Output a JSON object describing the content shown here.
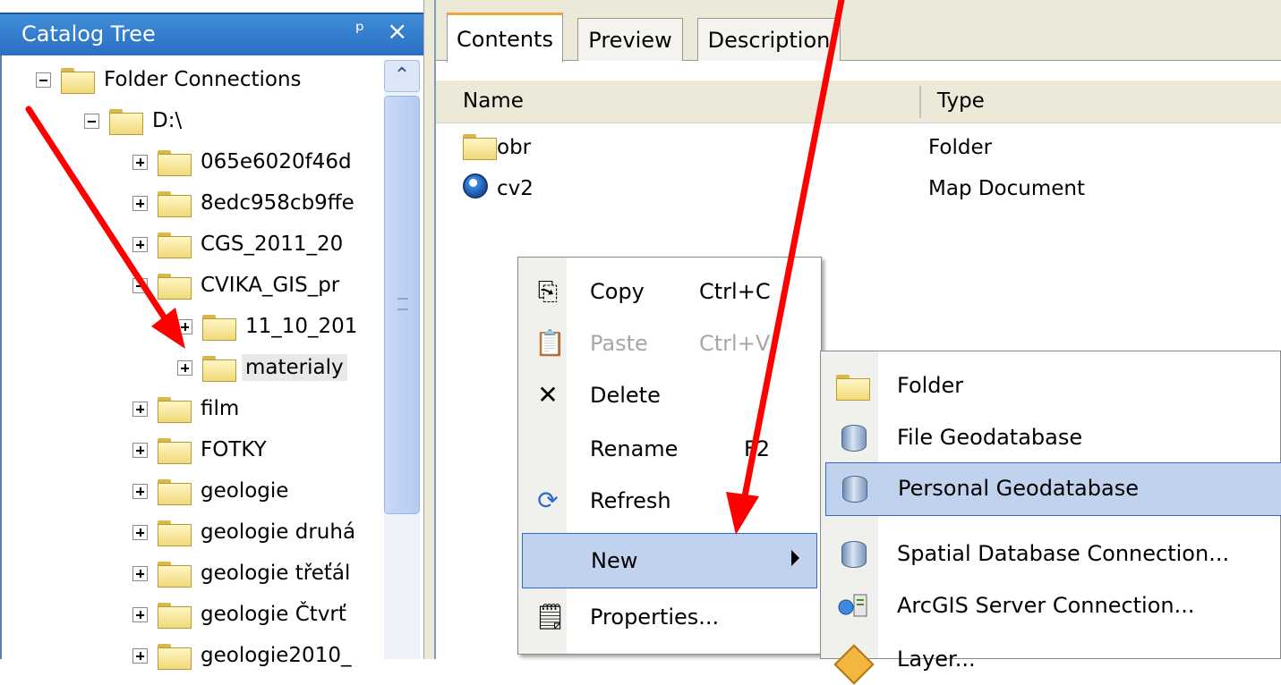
{
  "catalog_tree": {
    "title": "Catalog Tree",
    "pin_glyph": "ᵖ",
    "close_glyph": "×",
    "items": [
      {
        "label": "Folder Connections",
        "expander": "minus"
      },
      {
        "label": "D:\\",
        "expander": "minus"
      },
      {
        "label": "065e6020f46d",
        "expander": "plus"
      },
      {
        "label": "8edc958cb9ffe",
        "expander": "plus"
      },
      {
        "label": "CGS_2011_20",
        "expander": "plus"
      },
      {
        "label": "CVIKA_GIS_pr",
        "expander": "minus"
      },
      {
        "label": "11_10_201",
        "expander": "plus"
      },
      {
        "label": "materialy",
        "expander": "plus",
        "selected": true
      },
      {
        "label": "film",
        "expander": "plus"
      },
      {
        "label": "FOTKY",
        "expander": "plus"
      },
      {
        "label": "geologie",
        "expander": "plus"
      },
      {
        "label": "geologie druhá",
        "expander": "plus"
      },
      {
        "label": "geologie třeťál",
        "expander": "plus"
      },
      {
        "label": "geologie Čtvrť",
        "expander": "plus"
      },
      {
        "label": "geologie2010_",
        "expander": "plus"
      }
    ]
  },
  "tabs": [
    {
      "label": "Contents",
      "active": true
    },
    {
      "label": "Preview"
    },
    {
      "label": "Description"
    }
  ],
  "list": {
    "columns": {
      "name": "Name",
      "type": "Type"
    },
    "rows": [
      {
        "name": "obr",
        "type": "Folder",
        "icon": "folder-icon"
      },
      {
        "name": "cv2",
        "type": "Map Document",
        "icon": "map-document-icon"
      }
    ]
  },
  "context_menu": {
    "items": [
      {
        "label": "Copy",
        "shortcut": "Ctrl+C",
        "icon": "copy-icon"
      },
      {
        "label": "Paste",
        "shortcut": "Ctrl+V",
        "icon": "paste-icon",
        "disabled": true
      },
      {
        "label": "Delete",
        "shortcut": "",
        "icon": "delete-icon"
      },
      {
        "label": "Rename",
        "shortcut": "F2",
        "icon": ""
      },
      {
        "label": "Refresh",
        "shortcut": "",
        "icon": "refresh-icon"
      },
      {
        "label": "New",
        "shortcut": "",
        "icon": "",
        "highlight": true,
        "submenu": true
      },
      {
        "label": "Properties...",
        "shortcut": "",
        "icon": "properties-icon"
      }
    ]
  },
  "submenu": {
    "items": [
      {
        "label": "Folder",
        "icon": "folder-icon"
      },
      {
        "label": "File Geodatabase",
        "icon": "file-geodatabase-icon"
      },
      {
        "label": "Personal Geodatabase",
        "icon": "personal-geodatabase-icon",
        "highlight": true
      },
      {
        "label": "Spatial Database Connection...",
        "icon": "spatial-database-connection-icon"
      },
      {
        "label": "ArcGIS Server Connection...",
        "icon": "arcgis-server-connection-icon"
      },
      {
        "label": "Layer...",
        "icon": "layer-icon"
      }
    ]
  },
  "colors": {
    "annotation_arrow": "#ff0000",
    "highlight": "#c1d2ee",
    "titlebar": "#2a6fc4"
  }
}
